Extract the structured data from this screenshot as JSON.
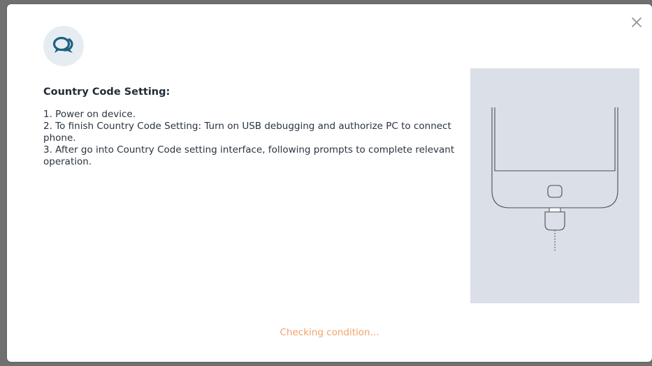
{
  "dialog": {
    "title": "Country Code Setting:",
    "steps": [
      "1. Power on device.",
      "2. To finish Country Code Setting: Turn on USB debugging and authorize PC to connect phone.",
      "3. After go into Country Code setting interface, following prompts to complete relevant operation."
    ],
    "status": "Checking condition...",
    "icons": {
      "logo": "chat-bubbles-icon",
      "close": "close-icon",
      "illustration": "phone-usb-connection-illustration"
    }
  },
  "colors": {
    "backdrop": "#6e6e6e",
    "dialog_bg": "#ffffff",
    "logo_bg": "#e6edf2",
    "logo_fg": "#1f5f80",
    "title": "#222c36",
    "text": "#2a3440",
    "illustration_bg": "#dbe0e8",
    "status": "#f2a26a"
  }
}
